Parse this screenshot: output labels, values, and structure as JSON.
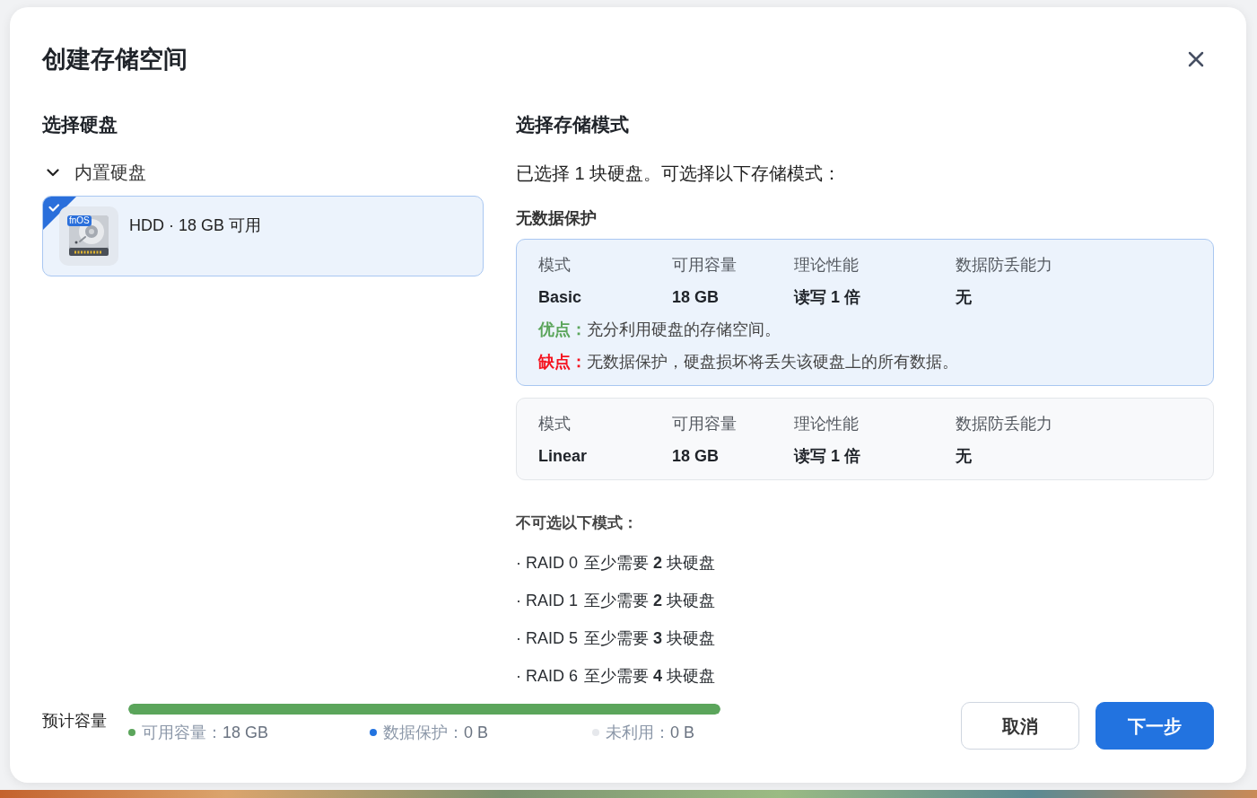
{
  "dialog": {
    "title": "创建存储空间"
  },
  "disk_section": {
    "heading": "选择硬盘",
    "groups": [
      {
        "label": "内置硬盘",
        "expanded": true,
        "disks": [
          {
            "badge": "fnOS",
            "label": "HDD · 18 GB 可用",
            "selected": true
          }
        ]
      }
    ]
  },
  "mode_section": {
    "heading": "选择存储模式",
    "summary": "已选择 1 块硬盘。可选择以下存储模式：",
    "group_label": "无数据保护",
    "modes": [
      {
        "selected": true,
        "header": [
          "模式",
          "可用容量",
          "理论性能",
          "数据防丢能力"
        ],
        "values": [
          "Basic",
          "18 GB",
          "读写 1 倍",
          "无"
        ],
        "notes": [
          {
            "kind": "pro",
            "label": "优点：",
            "text": "充分利用硬盘的存储空间。"
          },
          {
            "kind": "con",
            "label": "缺点：",
            "text": "无数据保护，硬盘损坏将丢失该硬盘上的所有数据。"
          }
        ]
      },
      {
        "selected": false,
        "header": [
          "模式",
          "可用容量",
          "理论性能",
          "数据防丢能力"
        ],
        "values": [
          "Linear",
          "18 GB",
          "读写 1 倍",
          "无"
        ]
      }
    ],
    "unavailable_heading": "不可选以下模式：",
    "unavailable": [
      {
        "name": "· RAID 0",
        "requirement": "至少需要 **2** 块硬盘"
      },
      {
        "name": "· RAID 1",
        "requirement": "至少需要 **2** 块硬盘"
      },
      {
        "name": "· RAID 5",
        "requirement": "至少需要 **3** 块硬盘"
      },
      {
        "name": "· RAID 6",
        "requirement": "至少需要 **4** 块硬盘"
      }
    ]
  },
  "footer": {
    "label": "预计容量",
    "level": 1,
    "segments": [
      {
        "label": "可用容量：",
        "value": "18 GB",
        "color": "#5ba55b"
      },
      {
        "label": "数据保护：",
        "value": "0 B",
        "color": "#2273e0"
      },
      {
        "label": "未利用：",
        "value": "0 B",
        "color": "#e6e8ec"
      }
    ],
    "buttons": [
      {
        "kind": "cancel",
        "label": "取消"
      },
      {
        "kind": "next",
        "label": "下一步"
      }
    ]
  }
}
